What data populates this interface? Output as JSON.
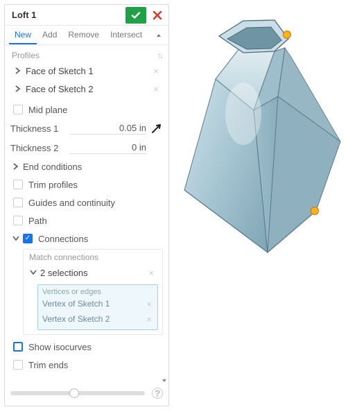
{
  "title": "Loft 1",
  "tabs": {
    "items": [
      "New",
      "Add",
      "Remove",
      "Intersect"
    ],
    "active": 0
  },
  "profiles": {
    "label": "Profiles",
    "items": [
      "Face of Sketch 1",
      "Face of Sketch 2"
    ]
  },
  "mid_plane": {
    "label": "Mid plane",
    "checked": false
  },
  "thickness1": {
    "label": "Thickness 1",
    "value": "0.05 in"
  },
  "thickness2": {
    "label": "Thickness 2",
    "value": "0 in"
  },
  "end_conditions": {
    "label": "End conditions"
  },
  "trim_profiles": {
    "label": "Trim profiles",
    "checked": false
  },
  "guides": {
    "label": "Guides and continuity",
    "checked": false
  },
  "path": {
    "label": "Path",
    "checked": false
  },
  "connections": {
    "label": "Connections",
    "checked": true,
    "match_label": "Match connections",
    "selections_label": "2 selections",
    "vert_label": "Vertices or edges",
    "items": [
      "Vertex of Sketch 1",
      "Vertex of Sketch 2"
    ]
  },
  "show_iso": {
    "label": "Show isocurves",
    "checked": false,
    "highlighted": true
  },
  "trim_ends": {
    "label": "Trim ends",
    "checked": false
  },
  "colors": {
    "accent": "#1a73e8",
    "accept": "#21a047",
    "cancel": "#d23a2e",
    "handle": "#ffb020"
  }
}
